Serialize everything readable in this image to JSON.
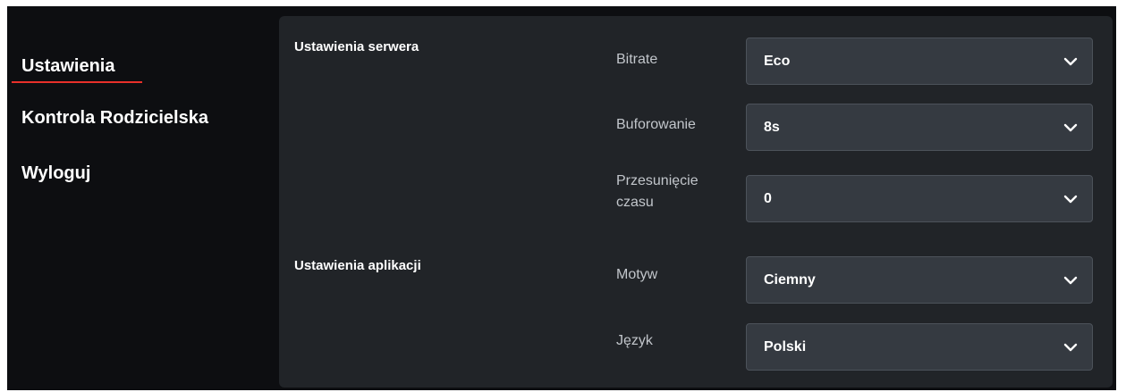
{
  "sidebar": {
    "items": [
      {
        "label": "Ustawienia",
        "active": true
      },
      {
        "label": "Kontrola Rodzicielska",
        "active": false
      },
      {
        "label": "Wyloguj",
        "active": false
      }
    ],
    "active_indicator_color": "#e8302a"
  },
  "server_settings": {
    "title": "Ustawienia serwera",
    "fields": [
      {
        "label": "Bitrate",
        "value": "Eco"
      },
      {
        "label": "Buforowanie",
        "value": "8s"
      },
      {
        "label": "Przesunięcie czasu",
        "value": "0"
      }
    ]
  },
  "app_settings": {
    "title": "Ustawienia aplikacji",
    "fields": [
      {
        "label": "Motyw",
        "value": "Ciemny"
      },
      {
        "label": "Język",
        "value": "Polski"
      }
    ]
  },
  "icons": {
    "select_chevron": "chevron-down-icon"
  },
  "colors": {
    "background": "#0d0e11",
    "panel": "#212428",
    "select": "#353a41",
    "accent": "#e8302a"
  }
}
